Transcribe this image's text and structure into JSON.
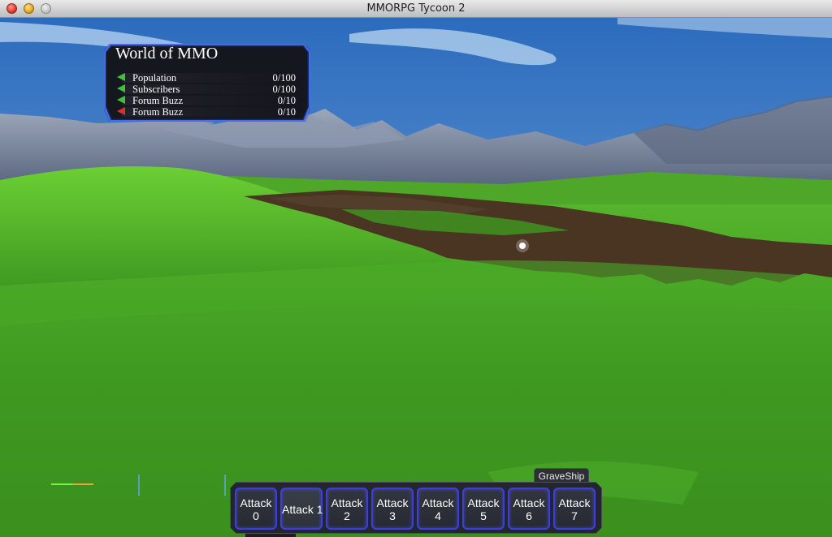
{
  "window": {
    "title": "MMORPG Tycoon 2"
  },
  "stats_panel": {
    "title": "World of MMO",
    "rows": [
      {
        "label": "Population",
        "value": "0/100",
        "trend": "up",
        "color": "#3ec23a"
      },
      {
        "label": "Subscribers",
        "value": "0/100",
        "trend": "up",
        "color": "#3ec23a"
      },
      {
        "label": "Forum Buzz",
        "value": "0/10",
        "trend": "up",
        "color": "#3ec23a"
      },
      {
        "label": "Forum Buzz",
        "value": "0/10",
        "trend": "down",
        "color": "#d83030"
      }
    ]
  },
  "action_bar": {
    "unit_name": "GraveShip",
    "slots": [
      {
        "line1": "Attack",
        "line2": "0"
      },
      {
        "line1": "Attack 1",
        "line2": ""
      },
      {
        "line1": "Attack",
        "line2": "2"
      },
      {
        "line1": "Attack",
        "line2": "3"
      },
      {
        "line1": "Attack",
        "line2": "4"
      },
      {
        "line1": "Attack",
        "line2": "5"
      },
      {
        "line1": "Attack",
        "line2": "6"
      },
      {
        "line1": "Attack",
        "line2": "7"
      }
    ]
  },
  "colors": {
    "sky_top": "#2f6fc0",
    "sky_bottom": "#7fb2df",
    "grass": "#3f9a21",
    "grass_light": "#5fc22f",
    "dirt": "#4a3523",
    "mountains": "#6f7e95",
    "slot_border": "#3c3fe0"
  }
}
